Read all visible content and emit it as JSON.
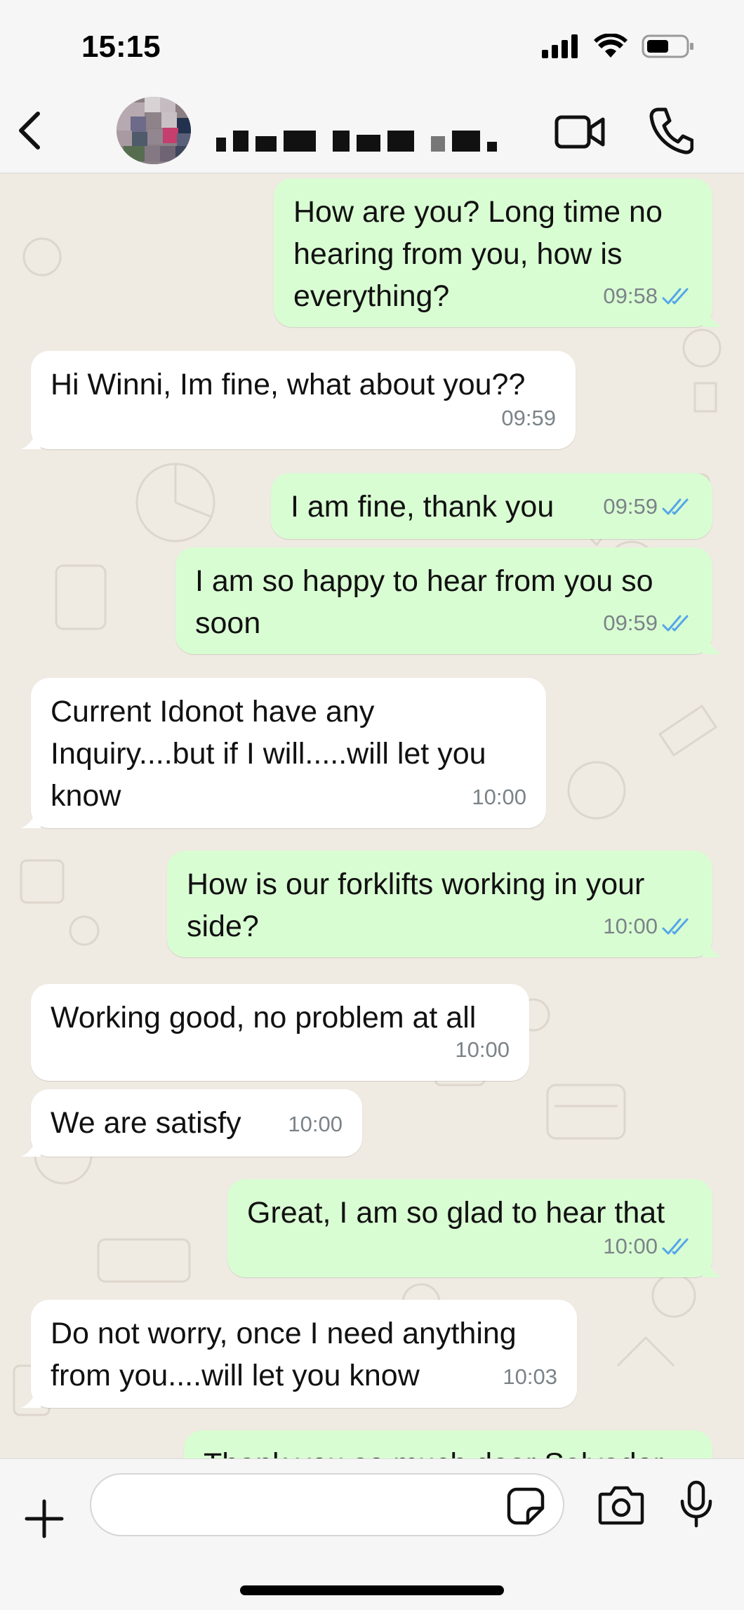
{
  "status_bar": {
    "time": "15:15"
  },
  "header": {
    "back_icon": "chevron-left-icon",
    "video_icon": "video-camera-icon",
    "call_icon": "phone-icon"
  },
  "messages": [
    {
      "direction": "out",
      "text": "How are you? Long time no\nhearing from you, how is\neverything?",
      "time": "09:58",
      "read": true
    },
    {
      "direction": "in",
      "text": "Hi Winni, Im fine, what about you??",
      "time": "09:59"
    },
    {
      "direction": "out",
      "text": "I am fine, thank you",
      "time": "09:59",
      "read": true
    },
    {
      "direction": "out",
      "text": "I am so happy to hear from you so\nsoon",
      "time": "09:59",
      "read": true
    },
    {
      "direction": "in",
      "text": "Current Idonot have any\nInquiry....but if I will.....will let you\nknow",
      "time": "10:00"
    },
    {
      "direction": "out",
      "text": "How is our forklifts working in your\nside?",
      "time": "10:00",
      "read": true
    },
    {
      "direction": "in",
      "text": "Working good, no problem at all",
      "time": "10:00"
    },
    {
      "direction": "in",
      "text": "We are satisfy",
      "time": "10:00"
    },
    {
      "direction": "out",
      "text": "Great, I am so glad to hear that",
      "time": "10:00",
      "read": true
    },
    {
      "direction": "in",
      "text": "Do not worry, once I need anything\nfrom you....will let you know",
      "time": "10:03"
    },
    {
      "direction": "out",
      "text": "Thank you so much dear Salvador",
      "time": "",
      "read": true
    }
  ],
  "composer": {
    "placeholder": "",
    "icons": [
      "plus-icon",
      "sticker-icon",
      "camera-icon",
      "microphone-icon"
    ]
  },
  "colors": {
    "outgoing_bubble": "#d9fdd3",
    "incoming_bubble": "#ffffff",
    "chat_background": "#efeae2",
    "read_ticks": "#53a6e8"
  }
}
